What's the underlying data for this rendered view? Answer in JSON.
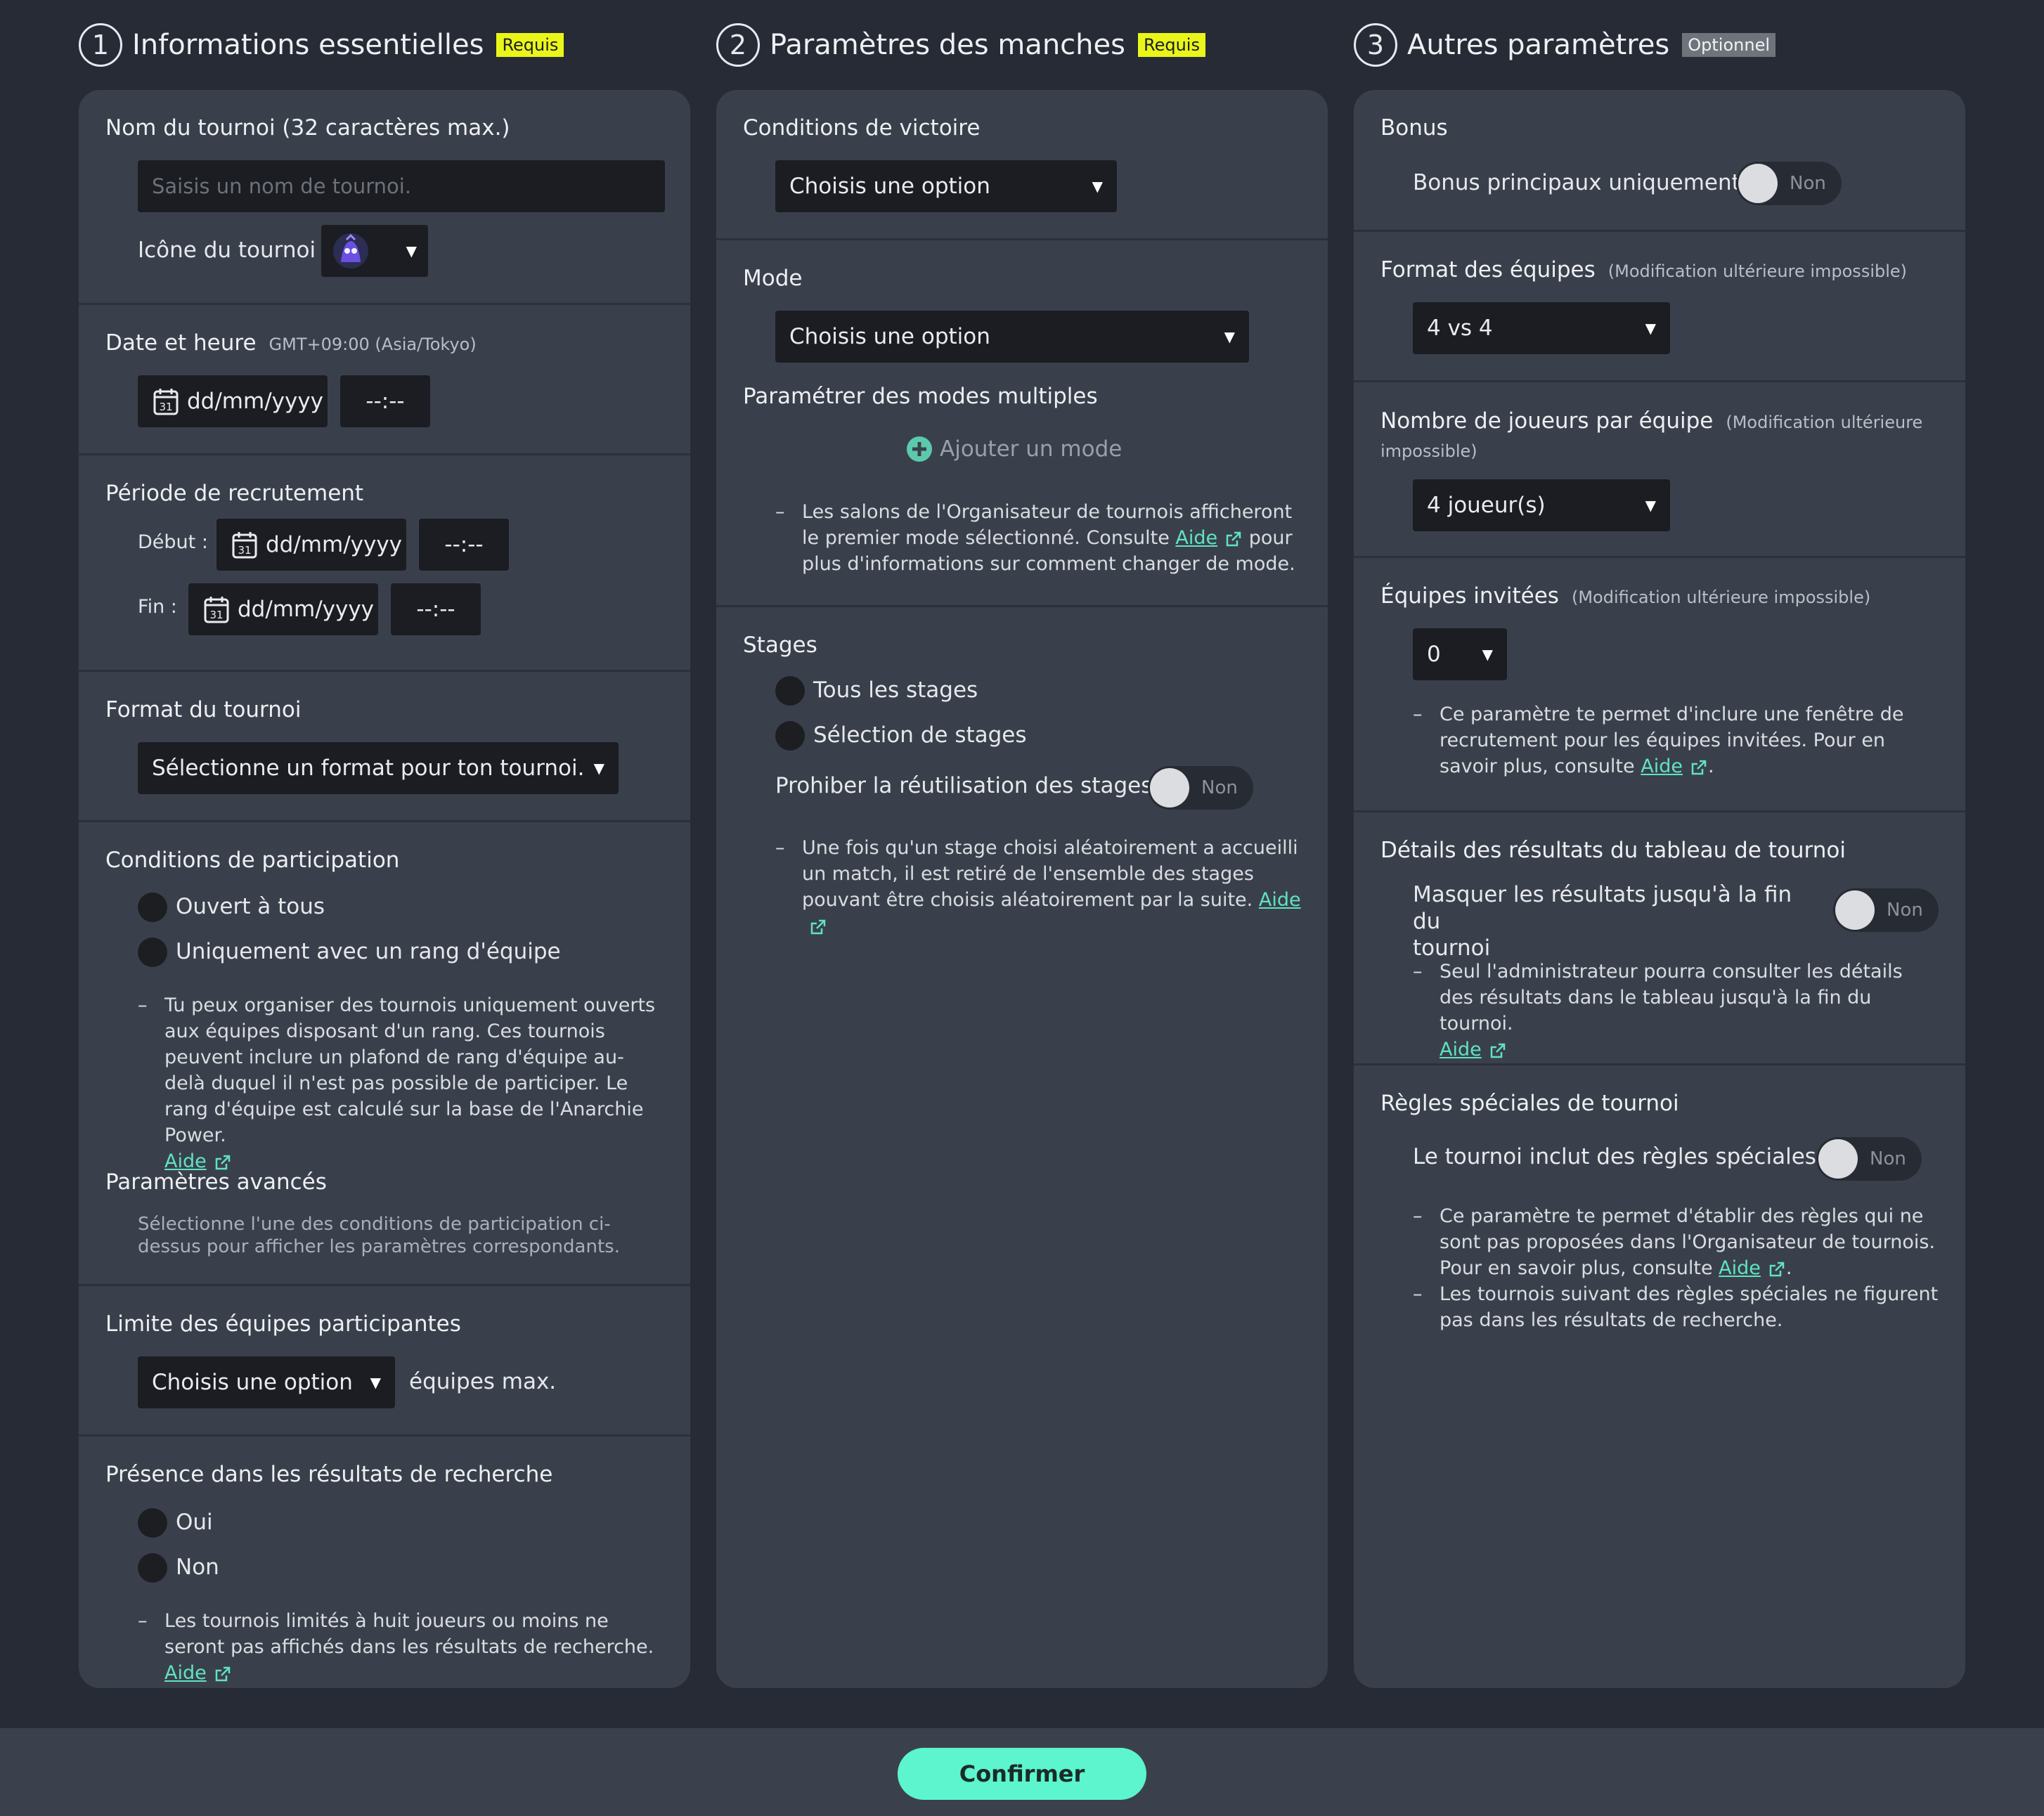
{
  "columns": [
    {
      "num": "1",
      "title": "Informations essentielles",
      "tag": "Requis"
    },
    {
      "num": "2",
      "title": "Paramètres des manches",
      "tag": "Requis"
    },
    {
      "num": "3",
      "title": "Autres paramètres",
      "tag": "Optionnel"
    }
  ],
  "col1": {
    "name": {
      "title": "Nom du tournoi (32 caractères max.)",
      "placeholder": "Saisis un nom de tournoi.",
      "icon_label": "Icône du tournoi"
    },
    "date": {
      "title": "Date et heure",
      "tz": "GMT+09:00 (Asia/Tokyo)",
      "date": "dd/mm/yyyy",
      "time": "--:--"
    },
    "recruit": {
      "title": "Période de recrutement",
      "start_label": "Début :",
      "end_label": "Fin :",
      "date": "dd/mm/yyyy",
      "time": "--:--"
    },
    "format": {
      "title": "Format du tournoi",
      "value": "Sélectionne un format pour ton tournoi."
    },
    "participation": {
      "title": "Conditions de participation",
      "opt1": "Ouvert à tous",
      "opt2": "Uniquement avec un rang d'équipe",
      "note": "Tu peux organiser des tournois uniquement ouverts aux équipes disposant d'un rang. Ces tournois peuvent inclure un plafond de rang d'équipe au-delà duquel il n'est pas possible de participer. Le rang d'équipe est calculé sur la base de l'Anarchie Power.",
      "help": "Aide",
      "adv_title": "Paramètres avancés",
      "adv_note": "Sélectionne l'une des conditions de participation ci-dessus pour afficher les paramètres correspondants."
    },
    "limit": {
      "title": "Limite des équipes participantes",
      "value": "Choisis une option",
      "suffix": "équipes max."
    },
    "search": {
      "title": "Présence dans les résultats de recherche",
      "opt1": "Oui",
      "opt2": "Non",
      "note": "Les tournois limités à huit joueurs ou moins ne seront pas affichés dans les résultats de recherche.",
      "help": "Aide"
    }
  },
  "col2": {
    "victory": {
      "title": "Conditions de victoire",
      "value": "Choisis une option"
    },
    "mode": {
      "title": "Mode",
      "value": "Choisis une option",
      "multi_title": "Paramétrer des modes multiples",
      "add": "Ajouter un mode",
      "note_a": "Les salons de l'Organisateur de tournois afficheront le premier mode sélectionné. Consulte",
      "help": "Aide",
      "note_b": "pour plus d'informations sur comment changer de mode."
    },
    "stages": {
      "title": "Stages",
      "opt1": "Tous les stages",
      "opt2": "Sélection de stages",
      "prohibit": "Prohiber la réutilisation des stages",
      "toggle": "Non",
      "note": "Une fois qu'un stage choisi aléatoirement a accueilli un match, il est retiré de l'ensemble des stages pouvant être choisis aléatoirement par la suite.",
      "help": "Aide"
    }
  },
  "col3": {
    "bonus": {
      "title": "Bonus",
      "label": "Bonus principaux uniquement",
      "toggle": "Non"
    },
    "team_format": {
      "title": "Format des équipes",
      "note": "(Modification ultérieure impossible)",
      "value": "4 vs 4"
    },
    "players": {
      "title": "Nombre de joueurs par équipe",
      "note_a": "(Modification ultérieure",
      "note_b": "impossible)",
      "value": "4 joueur(s)"
    },
    "invited": {
      "title": "Équipes invitées",
      "note": "(Modification ultérieure impossible)",
      "value": "0",
      "desc": "Ce paramètre te permet d'inclure une fenêtre de recrutement pour les équipes invitées. Pour en savoir plus, consulte",
      "help": "Aide"
    },
    "results": {
      "title": "Détails des résultats du tableau de tournoi",
      "label_a": "Masquer les résultats jusqu'à la fin du",
      "label_b": "tournoi",
      "toggle": "Non",
      "desc": "Seul l'administrateur pourra consulter les détails des résultats dans le tableau jusqu'à la fin du tournoi.",
      "help": "Aide"
    },
    "special": {
      "title": "Règles spéciales de tournoi",
      "label": "Le tournoi inclut des règles spéciales.",
      "toggle": "Non",
      "desc1": "Ce paramètre te permet d'établir des règles qui ne sont pas proposées dans l'Organisateur de tournois. Pour en savoir plus, consulte",
      "help": "Aide",
      "desc2": "Les tournois suivant des règles spéciales ne figurent pas dans les résultats de recherche."
    }
  },
  "footer": {
    "confirm": "Confirmer"
  },
  "colors": {
    "accent": "#5cf5cd",
    "required_tag": "#eaf51a",
    "link": "#5fe3c2"
  }
}
